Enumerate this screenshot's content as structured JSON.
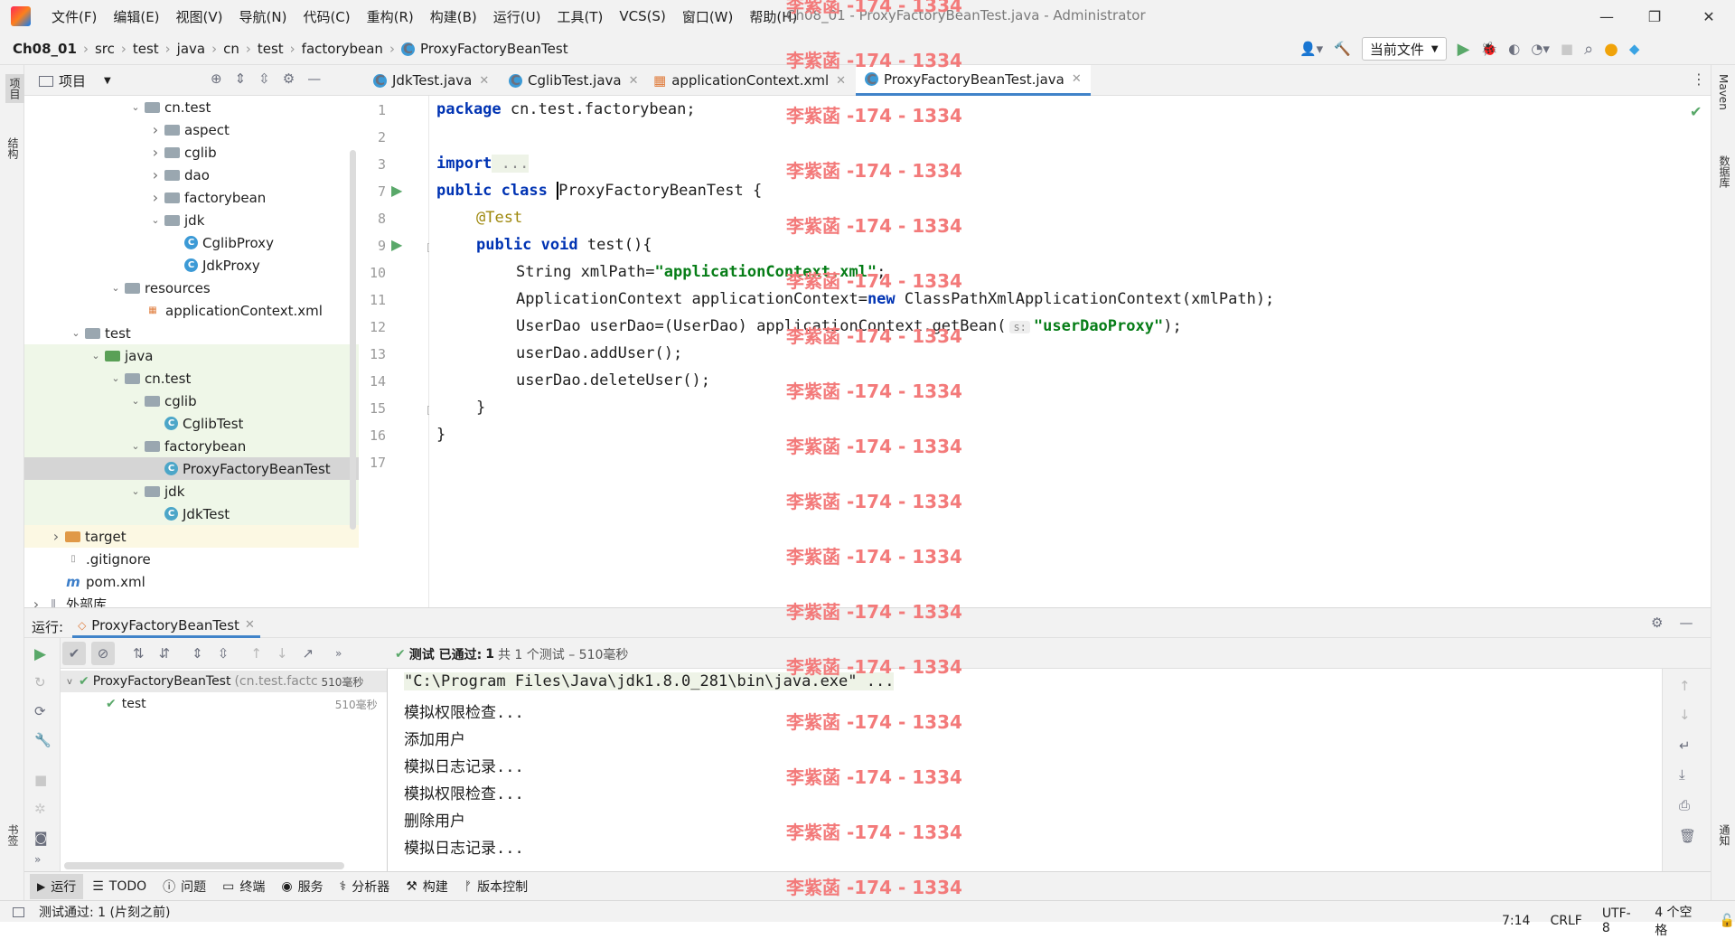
{
  "menu": [
    "文件(F)",
    "编辑(E)",
    "视图(V)",
    "导航(N)",
    "代码(C)",
    "重构(R)",
    "构建(B)",
    "运行(U)",
    "工具(T)",
    "VCS(S)",
    "窗口(W)",
    "帮助(H)"
  ],
  "window_title": "Ch08_01 - ProxyFactoryBeanTest.java - Administrator",
  "breadcrumb": [
    "Ch08_01",
    "src",
    "test",
    "java",
    "cn",
    "test",
    "factorybean",
    "ProxyFactoryBeanTest"
  ],
  "run_config": "当前文件",
  "left_strip": [
    "项目",
    "结构",
    "书签"
  ],
  "right_strip": [
    "Maven",
    "数据库",
    "通知"
  ],
  "project_panel": {
    "title": "项目"
  },
  "tree": [
    {
      "label": "cn.test",
      "type": "pkg",
      "depth": 5,
      "arrow": "v"
    },
    {
      "label": "aspect",
      "type": "pkg",
      "depth": 6,
      "arrow": ">"
    },
    {
      "label": "cglib",
      "type": "pkg",
      "depth": 6,
      "arrow": ">"
    },
    {
      "label": "dao",
      "type": "pkg",
      "depth": 6,
      "arrow": ">"
    },
    {
      "label": "factorybean",
      "type": "pkg",
      "depth": 6,
      "arrow": ">"
    },
    {
      "label": "jdk",
      "type": "pkg",
      "depth": 6,
      "arrow": "v"
    },
    {
      "label": "CglibProxy",
      "type": "class",
      "depth": 7,
      "arrow": ""
    },
    {
      "label": "JdkProxy",
      "type": "class",
      "depth": 7,
      "arrow": ""
    },
    {
      "label": "resources",
      "type": "folder",
      "depth": 4,
      "arrow": "v"
    },
    {
      "label": "applicationContext.xml",
      "type": "xml",
      "depth": 5,
      "arrow": ""
    },
    {
      "label": "test",
      "type": "folder",
      "depth": 2,
      "arrow": "v"
    },
    {
      "label": "java",
      "type": "testfolder",
      "depth": 3,
      "arrow": "v"
    },
    {
      "label": "cn.test",
      "type": "pkg",
      "depth": 4,
      "arrow": "v"
    },
    {
      "label": "cglib",
      "type": "pkg",
      "depth": 5,
      "arrow": "v"
    },
    {
      "label": "CglibTest",
      "type": "testclass",
      "depth": 6,
      "arrow": ""
    },
    {
      "label": "factorybean",
      "type": "pkg",
      "depth": 5,
      "arrow": "v"
    },
    {
      "label": "ProxyFactoryBeanTest",
      "type": "testclass",
      "depth": 6,
      "arrow": "",
      "selected": true
    },
    {
      "label": "jdk",
      "type": "pkg",
      "depth": 5,
      "arrow": "v"
    },
    {
      "label": "JdkTest",
      "type": "testclass",
      "depth": 6,
      "arrow": ""
    },
    {
      "label": "target",
      "type": "orange",
      "depth": 1,
      "arrow": ">"
    },
    {
      "label": ".gitignore",
      "type": "file",
      "depth": 1,
      "arrow": ""
    },
    {
      "label": "pom.xml",
      "type": "maven",
      "depth": 1,
      "arrow": ""
    },
    {
      "label": "外部库",
      "type": "lib",
      "depth": 0,
      "arrow": ">"
    }
  ],
  "editor_tabs": [
    {
      "label": "JdkTest.java",
      "icon": "class"
    },
    {
      "label": "CglibTest.java",
      "icon": "class"
    },
    {
      "label": "applicationContext.xml",
      "icon": "xml"
    },
    {
      "label": "ProxyFactoryBeanTest.java",
      "icon": "class",
      "active": true
    }
  ],
  "line_numbers": [
    "1",
    "2",
    "3",
    "7",
    "8",
    "9",
    "10",
    "11",
    "12",
    "13",
    "14",
    "15",
    "16",
    "17"
  ],
  "code": {
    "l1_kw": "package",
    "l1_rest": " cn.test.factorybean;",
    "l3_kw": "import",
    "l3_rest": " ...",
    "l7_kw": "public class",
    "l7_rest": "ProxyFactoryBeanTest {",
    "l8": "@Test",
    "l9_kw": "public void",
    "l9_rest": " test(){",
    "l10_a": "String xmlPath=",
    "l10_str": "\"applicationContext.xml\"",
    "l10_b": ";",
    "l11_a": "ApplicationContext applicationContext=",
    "l11_kw": "new",
    "l11_b": " ClassPathXmlApplicationContext(xmlPath);",
    "l12_a": "UserDao userDao=(UserDao) applicationContext.getBean(",
    "l12_hint": "s:",
    "l12_str": "\"userDaoProxy\"",
    "l12_b": ");",
    "l13": "userDao.addUser();",
    "l14": "userDao.deleteUser();",
    "l15": "}",
    "l16": "}"
  },
  "watermark": "李紫菡 -174 - 1334",
  "run_panel": {
    "label": "运行:",
    "tab": "ProxyFactoryBeanTest",
    "status_icon": "check-icon",
    "status_bold": "测试 已通过:",
    "status_count": "1",
    "status_rest": "共 1 个测试 – 510毫秒",
    "tests": [
      {
        "name": "ProxyFactoryBeanTest",
        "pkg": "(cn.test.factc",
        "time": "510毫秒"
      },
      {
        "name": "test",
        "time": "510毫秒"
      }
    ],
    "console": [
      "\"C:\\Program Files\\Java\\jdk1.8.0_281\\bin\\java.exe\" ...",
      "模拟权限检查...",
      "添加用户",
      "模拟日志记录...",
      "模拟权限检查...",
      "删除用户",
      "模拟日志记录..."
    ]
  },
  "bottom_tabs": [
    "运行",
    "TODO",
    "问题",
    "终端",
    "服务",
    "分析器",
    "构建",
    "版本控制"
  ],
  "status": {
    "message": "测试通过: 1 (片刻之前)",
    "position": "7:14",
    "line_sep": "CRLF",
    "encoding": "UTF-8",
    "indent": "4 个空格"
  },
  "colors": {
    "accent": "#4083c9",
    "watermark": "#f37a7a",
    "keyword": "#0033b3",
    "string": "#067d17",
    "pass": "#59a869"
  }
}
